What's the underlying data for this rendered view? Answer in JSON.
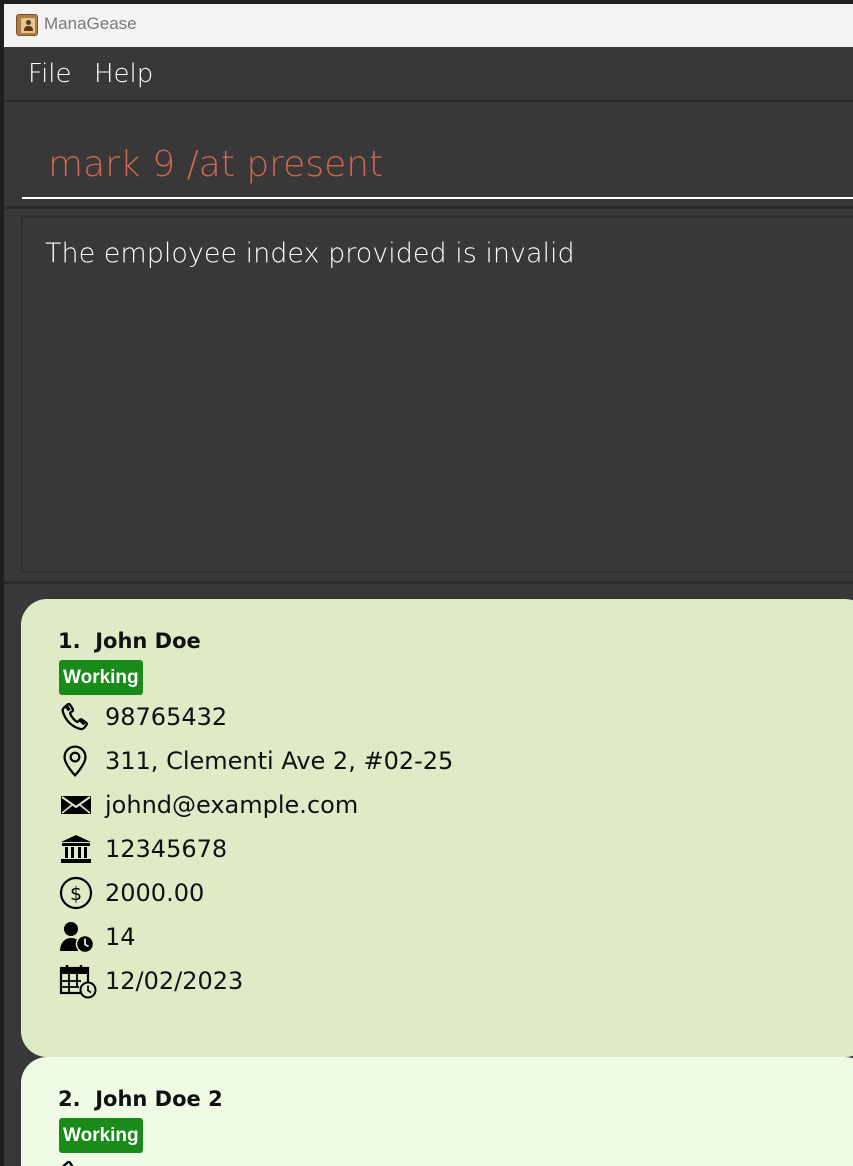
{
  "window": {
    "title": "ManaGease"
  },
  "menu": {
    "file": "File",
    "help": "Help"
  },
  "command": {
    "value": "mark 9 /at present"
  },
  "result": {
    "message": "The employee index provided is invalid"
  },
  "employees": [
    {
      "index": "1.",
      "name": "John Doe",
      "status": "Working",
      "phone": "98765432",
      "address": "311, Clementi Ave 2, #02-25",
      "email": "johnd@example.com",
      "bank": "12345678",
      "salary": "2000.00",
      "leave": "14",
      "joined": "12/02/2023"
    },
    {
      "index": "2.",
      "name": "John Doe 2",
      "status": "Working"
    }
  ],
  "colors": {
    "background": "#383838",
    "command_text": "#d06651",
    "card_selected": "#dfebc7",
    "card_default": "#f0fbe5",
    "status_working": "#1a8a1a"
  }
}
